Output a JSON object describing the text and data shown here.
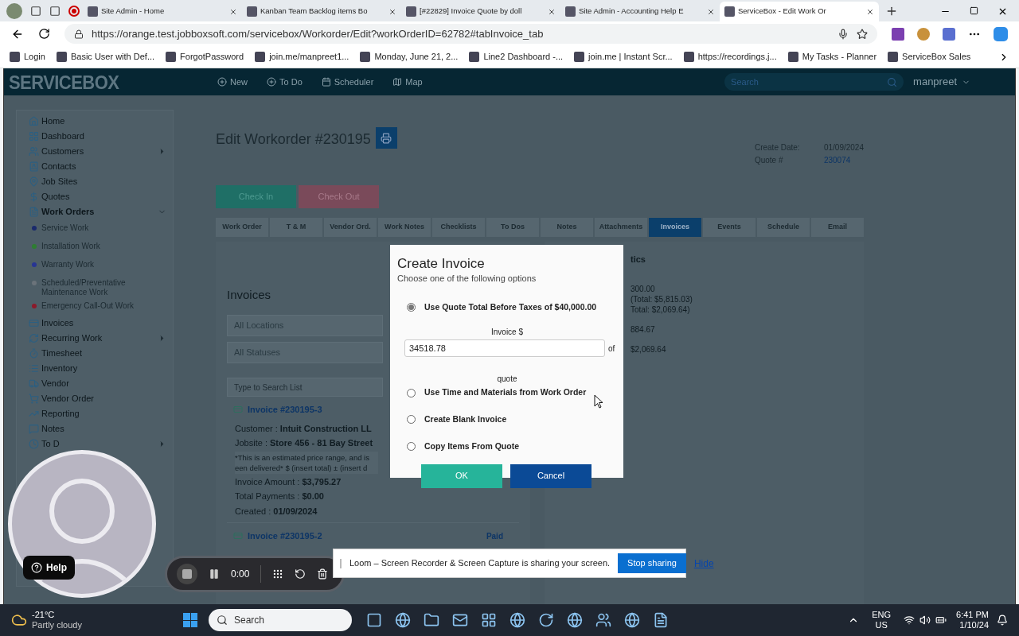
{
  "browser": {
    "tabs": [
      {
        "title": "Site Admin - Home",
        "selected": false
      },
      {
        "title": "Kanban Team Backlog items Bo",
        "selected": false
      },
      {
        "title": "[#22829] Invoice Quote by doll",
        "selected": false
      },
      {
        "title": "Site Admin - Accounting Help E",
        "selected": false
      },
      {
        "title": "ServiceBox - Edit Work Or",
        "selected": true
      }
    ],
    "url": "https://orange.test.jobboxsoft.com/servicebox/Workorder/Edit?workOrderID=62782#tabInvoice_tab",
    "bookmarks": [
      "Login",
      "Basic User with Def...",
      "ForgotPassword",
      "join.me/manpreet1...",
      "Monday, June 21, 2...",
      "Line2 Dashboard -...",
      "join.me | Instant Scr...",
      "https://recordings.j...",
      "My Tasks - Planner",
      "ServiceBox Sales"
    ]
  },
  "app": {
    "logo": "SERVICEBOX",
    "nav": [
      "New",
      "To Do",
      "Scheduler",
      "Map"
    ],
    "search": {
      "placeholder": "Search"
    },
    "user": "manpreet"
  },
  "sidebar": {
    "items": [
      {
        "label": "Home"
      },
      {
        "label": "Dashboard"
      },
      {
        "label": "Customers",
        "expanded": false
      },
      {
        "label": "Contacts"
      },
      {
        "label": "Job Sites"
      },
      {
        "label": "Quotes"
      },
      {
        "label": "Work Orders",
        "expanded": true,
        "children": [
          {
            "label": "Service Work",
            "color": "#1a2a6c"
          },
          {
            "label": "Installation Work",
            "color": "#2e7d32"
          },
          {
            "label": "Warranty Work",
            "color": "#283593"
          },
          {
            "label": "Scheduled/Preventative Maintenance Work",
            "color": "#6b737a"
          },
          {
            "label": "Emergency Call-Out Work",
            "color": "#8b1a2b"
          }
        ]
      },
      {
        "label": "Invoices"
      },
      {
        "label": "Recurring Work",
        "expanded": false
      },
      {
        "label": "Timesheet"
      },
      {
        "label": "Inventory"
      },
      {
        "label": "Vendor"
      },
      {
        "label": "Vendor Order"
      },
      {
        "label": "Reporting"
      },
      {
        "label": "Notes"
      },
      {
        "label": "To D",
        "expanded": false
      }
    ]
  },
  "page": {
    "title": "Edit Workorder #230195",
    "create_date_label": "Create Date:",
    "create_date": "01/09/2024",
    "quote_label": "Quote #",
    "quote": "230074",
    "check_in": "Check In",
    "check_out": "Check Out",
    "tabs": [
      {
        "label": "Work Order",
        "selected": false
      },
      {
        "label": "T & M",
        "selected": false
      },
      {
        "label": "Vendor Ord.",
        "selected": false
      },
      {
        "label": "Work Notes",
        "selected": false
      },
      {
        "label": "Checklists",
        "selected": false
      },
      {
        "label": "To Dos",
        "selected": false
      },
      {
        "label": "Notes",
        "selected": false
      },
      {
        "label": "Attachments",
        "selected": false
      },
      {
        "label": "Invoices",
        "selected": true
      },
      {
        "label": "Events",
        "selected": false
      },
      {
        "label": "Schedule",
        "selected": false
      },
      {
        "label": "Email",
        "selected": false
      }
    ]
  },
  "invoices": {
    "heading": "Invoices",
    "filters": [
      "All Locations",
      "All Statuses"
    ],
    "search": {
      "placeholder": "Type to Search List"
    },
    "entries": [
      {
        "title": "Invoice #230195-3",
        "customer_label": "Customer :",
        "customer": "Intuit Construction LL",
        "jobsite_label": "Jobsite :",
        "jobsite": "Store 456 - 81 Bay Street",
        "note_lines": [
          "*This is an estimated price range, and is",
          "een delivered* $ (insert total) ± (insert d"
        ],
        "amount_label": "Invoice Amount :",
        "amount": "$3,795.27",
        "payments_label": "Total Payments :",
        "payments": "$0.00",
        "created_label": "Created :",
        "created": "01/09/2024"
      },
      {
        "title": "Invoice #230195-2",
        "status": "Paid"
      }
    ]
  },
  "stats": {
    "heading": "tics",
    "lines": [
      "300.00",
      "(Total: $5,815.03)",
      "Total: $2,069.64)",
      "884.67",
      "$2,069.64"
    ]
  },
  "dialog": {
    "title": "Create Invoice",
    "subtitle": "Choose one of the following options",
    "options": [
      {
        "label": "Use Quote Total Before Taxes of $40,000.00",
        "selected": true
      },
      {
        "label": "Use Time and Materials from Work Order",
        "selected": false
      },
      {
        "label": "Create Blank Invoice",
        "selected": false
      },
      {
        "label": "Copy Items From Quote",
        "selected": false
      }
    ],
    "invoice_label": "Invoice $",
    "invoice_value": "34518.78",
    "of": "of",
    "quote_word": "quote",
    "ok": "OK",
    "cancel": "Cancel"
  },
  "loom": {
    "help": "Help",
    "timer": "0:00",
    "notice": "Loom – Screen Recorder & Screen Capture is sharing your screen.",
    "stop": "Stop sharing",
    "hide": "Hide"
  },
  "taskbar": {
    "temp": "-21°C",
    "condition": "Partly cloudy",
    "search": {
      "placeholder": "Search"
    },
    "lang": "ENG",
    "region": "US",
    "time": "6:41 PM",
    "date": "1/10/24"
  }
}
